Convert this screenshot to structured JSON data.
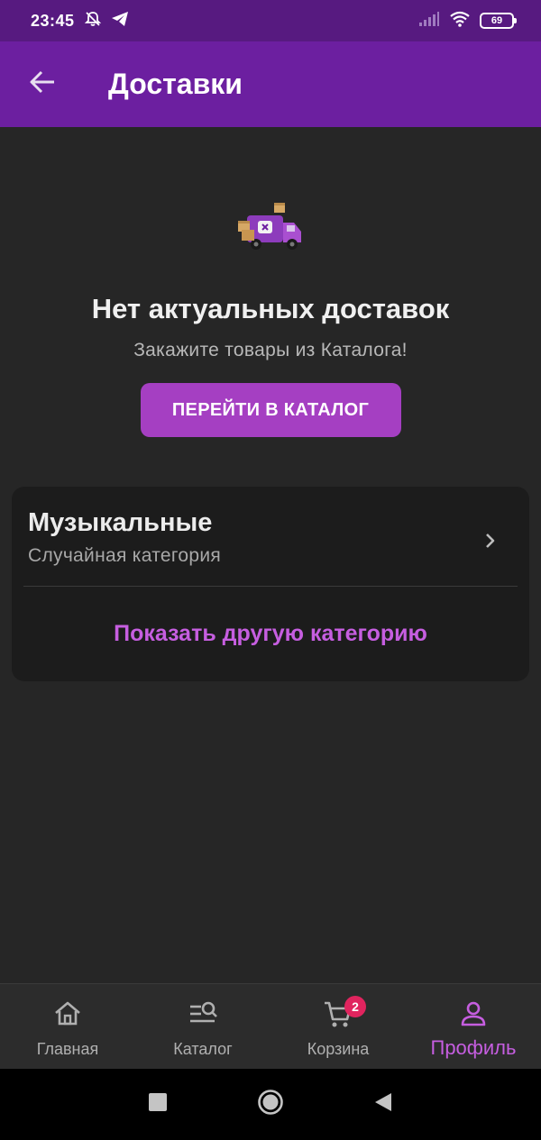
{
  "status_bar": {
    "time": "23:45",
    "battery": "69"
  },
  "app_bar": {
    "title": "Доставки"
  },
  "empty_state": {
    "title": "Нет актуальных доставок",
    "subtitle": "Закажите товары из Каталога!",
    "button_label": "ПЕРЕЙТИ В КАТАЛОГ"
  },
  "category_card": {
    "name": "Музыкальные",
    "caption": "Случайная категория",
    "show_other_label": "Показать другую категорию"
  },
  "bottom_nav": {
    "items": [
      {
        "label": "Главная",
        "icon": "home-icon"
      },
      {
        "label": "Каталог",
        "icon": "catalog-search-icon"
      },
      {
        "label": "Корзина",
        "icon": "cart-icon",
        "badge": "2"
      },
      {
        "label": "Профиль",
        "icon": "profile-icon",
        "active": true
      }
    ]
  },
  "colors": {
    "status_bar": "#571a80",
    "app_bar": "#6c1fa0",
    "accent": "#a53fc2",
    "accent_text": "#c65ee0",
    "badge": "#e0245e",
    "background": "#262626"
  }
}
